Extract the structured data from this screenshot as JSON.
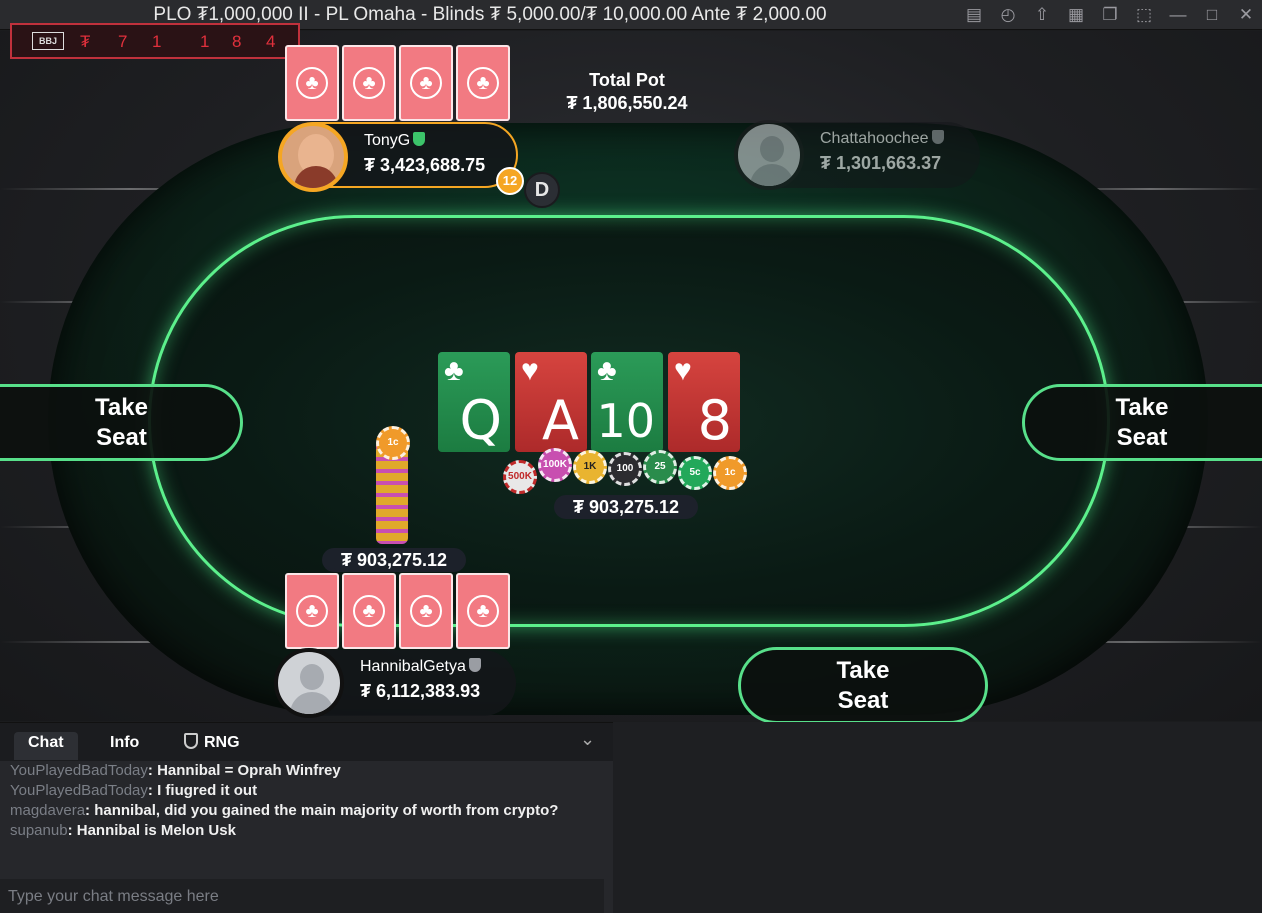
{
  "title": "PLO ₮1,000,000 II - PL Omaha - Blinds ₮ 5,000.00/₮ 10,000.00 Ante ₮ 2,000.00",
  "window_icons": [
    "notes-icon",
    "history-icon",
    "share-icon",
    "grid-icon",
    "layers-icon",
    "resize-icon",
    "minimize-icon",
    "maximize-icon",
    "close-icon"
  ],
  "history": {
    "badge": "BBJ",
    "values": [
      "₮",
      "7",
      "1",
      "1",
      "8",
      "4"
    ]
  },
  "pot": {
    "label": "Total Pot",
    "total": "₮ 1,806,550.24",
    "main_pot": "₮ 903,275.12",
    "bet": "₮ 903,275.12"
  },
  "players": [
    {
      "name": "TonyG",
      "stack": "₮ 3,423,688.75",
      "timer": "12",
      "verified": true
    },
    {
      "name": "Chattahoochee",
      "stack": "₮ 1,301,663.37"
    },
    {
      "name": "HannibalGetya",
      "stack": "₮ 6,112,383.93"
    }
  ],
  "dealer": "D",
  "board": [
    {
      "rank": "Q",
      "suit": "♣",
      "color": "green"
    },
    {
      "rank": "A",
      "suit": "♥",
      "color": "red"
    },
    {
      "rank": "10",
      "suit": "♣",
      "color": "green"
    },
    {
      "rank": "8",
      "suit": "♥",
      "color": "red"
    }
  ],
  "chips": [
    "500K",
    "100K",
    "1K",
    "100",
    "25",
    "5c",
    "1c"
  ],
  "stack_top_chip": "1c",
  "take_seat": "Take Seat",
  "chat": {
    "tabs": [
      "Chat",
      "Info",
      "RNG"
    ],
    "messages": [
      {
        "user": "YouPlayedBadToday",
        "text": "Hannibal = Oprah Winfrey"
      },
      {
        "user": "YouPlayedBadToday",
        "text": "I fiugred it out"
      },
      {
        "user": "magdavera",
        "text": "hannibal, did you gained the main majority of worth from crypto?"
      },
      {
        "user": "supanub",
        "text": "Hannibal is Melon Usk"
      }
    ],
    "placeholder": "Type your chat message here"
  },
  "colors": {
    "felt_rim": "#5cf08c",
    "card_back": "#f27a82",
    "history_border": "#c0313c",
    "timer": "#f5a623"
  }
}
